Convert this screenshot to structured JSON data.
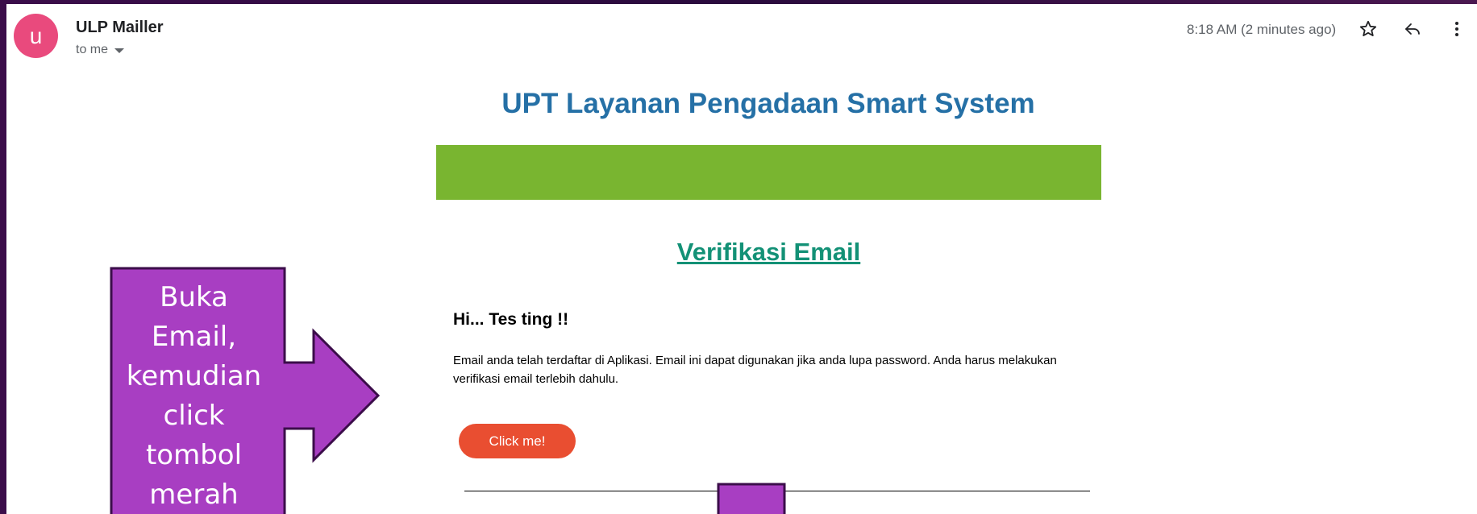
{
  "email": {
    "sender_initial": "u",
    "sender_name": "ULP Mailler",
    "recipient": "to me",
    "timestamp": "8:18 AM (2 minutes ago)",
    "icons": [
      "star-icon",
      "reply-icon",
      "more-vert-icon"
    ]
  },
  "body": {
    "title": "UPT Layanan Pengadaan Smart System",
    "heading": "Verifikasi Email",
    "greeting": "Hi... Tes ting !!",
    "paragraph": "Email anda telah terdaftar di Aplikasi. Email ini dapat digunakan jika anda lupa password. Anda harus melakukan verifikasi email terlebih dahulu.",
    "button_label": "Click me!"
  },
  "callout": {
    "lines": [
      "Buka",
      "Email,",
      "kemudian",
      "click",
      "tombol",
      "merah"
    ]
  },
  "colors": {
    "avatar": "#e94a7d",
    "title": "#2570a6",
    "banner": "#79b530",
    "heading": "#139176",
    "button": "#e94e31",
    "callout_fill": "#a83ec2",
    "callout_border": "#3b0d4a"
  }
}
